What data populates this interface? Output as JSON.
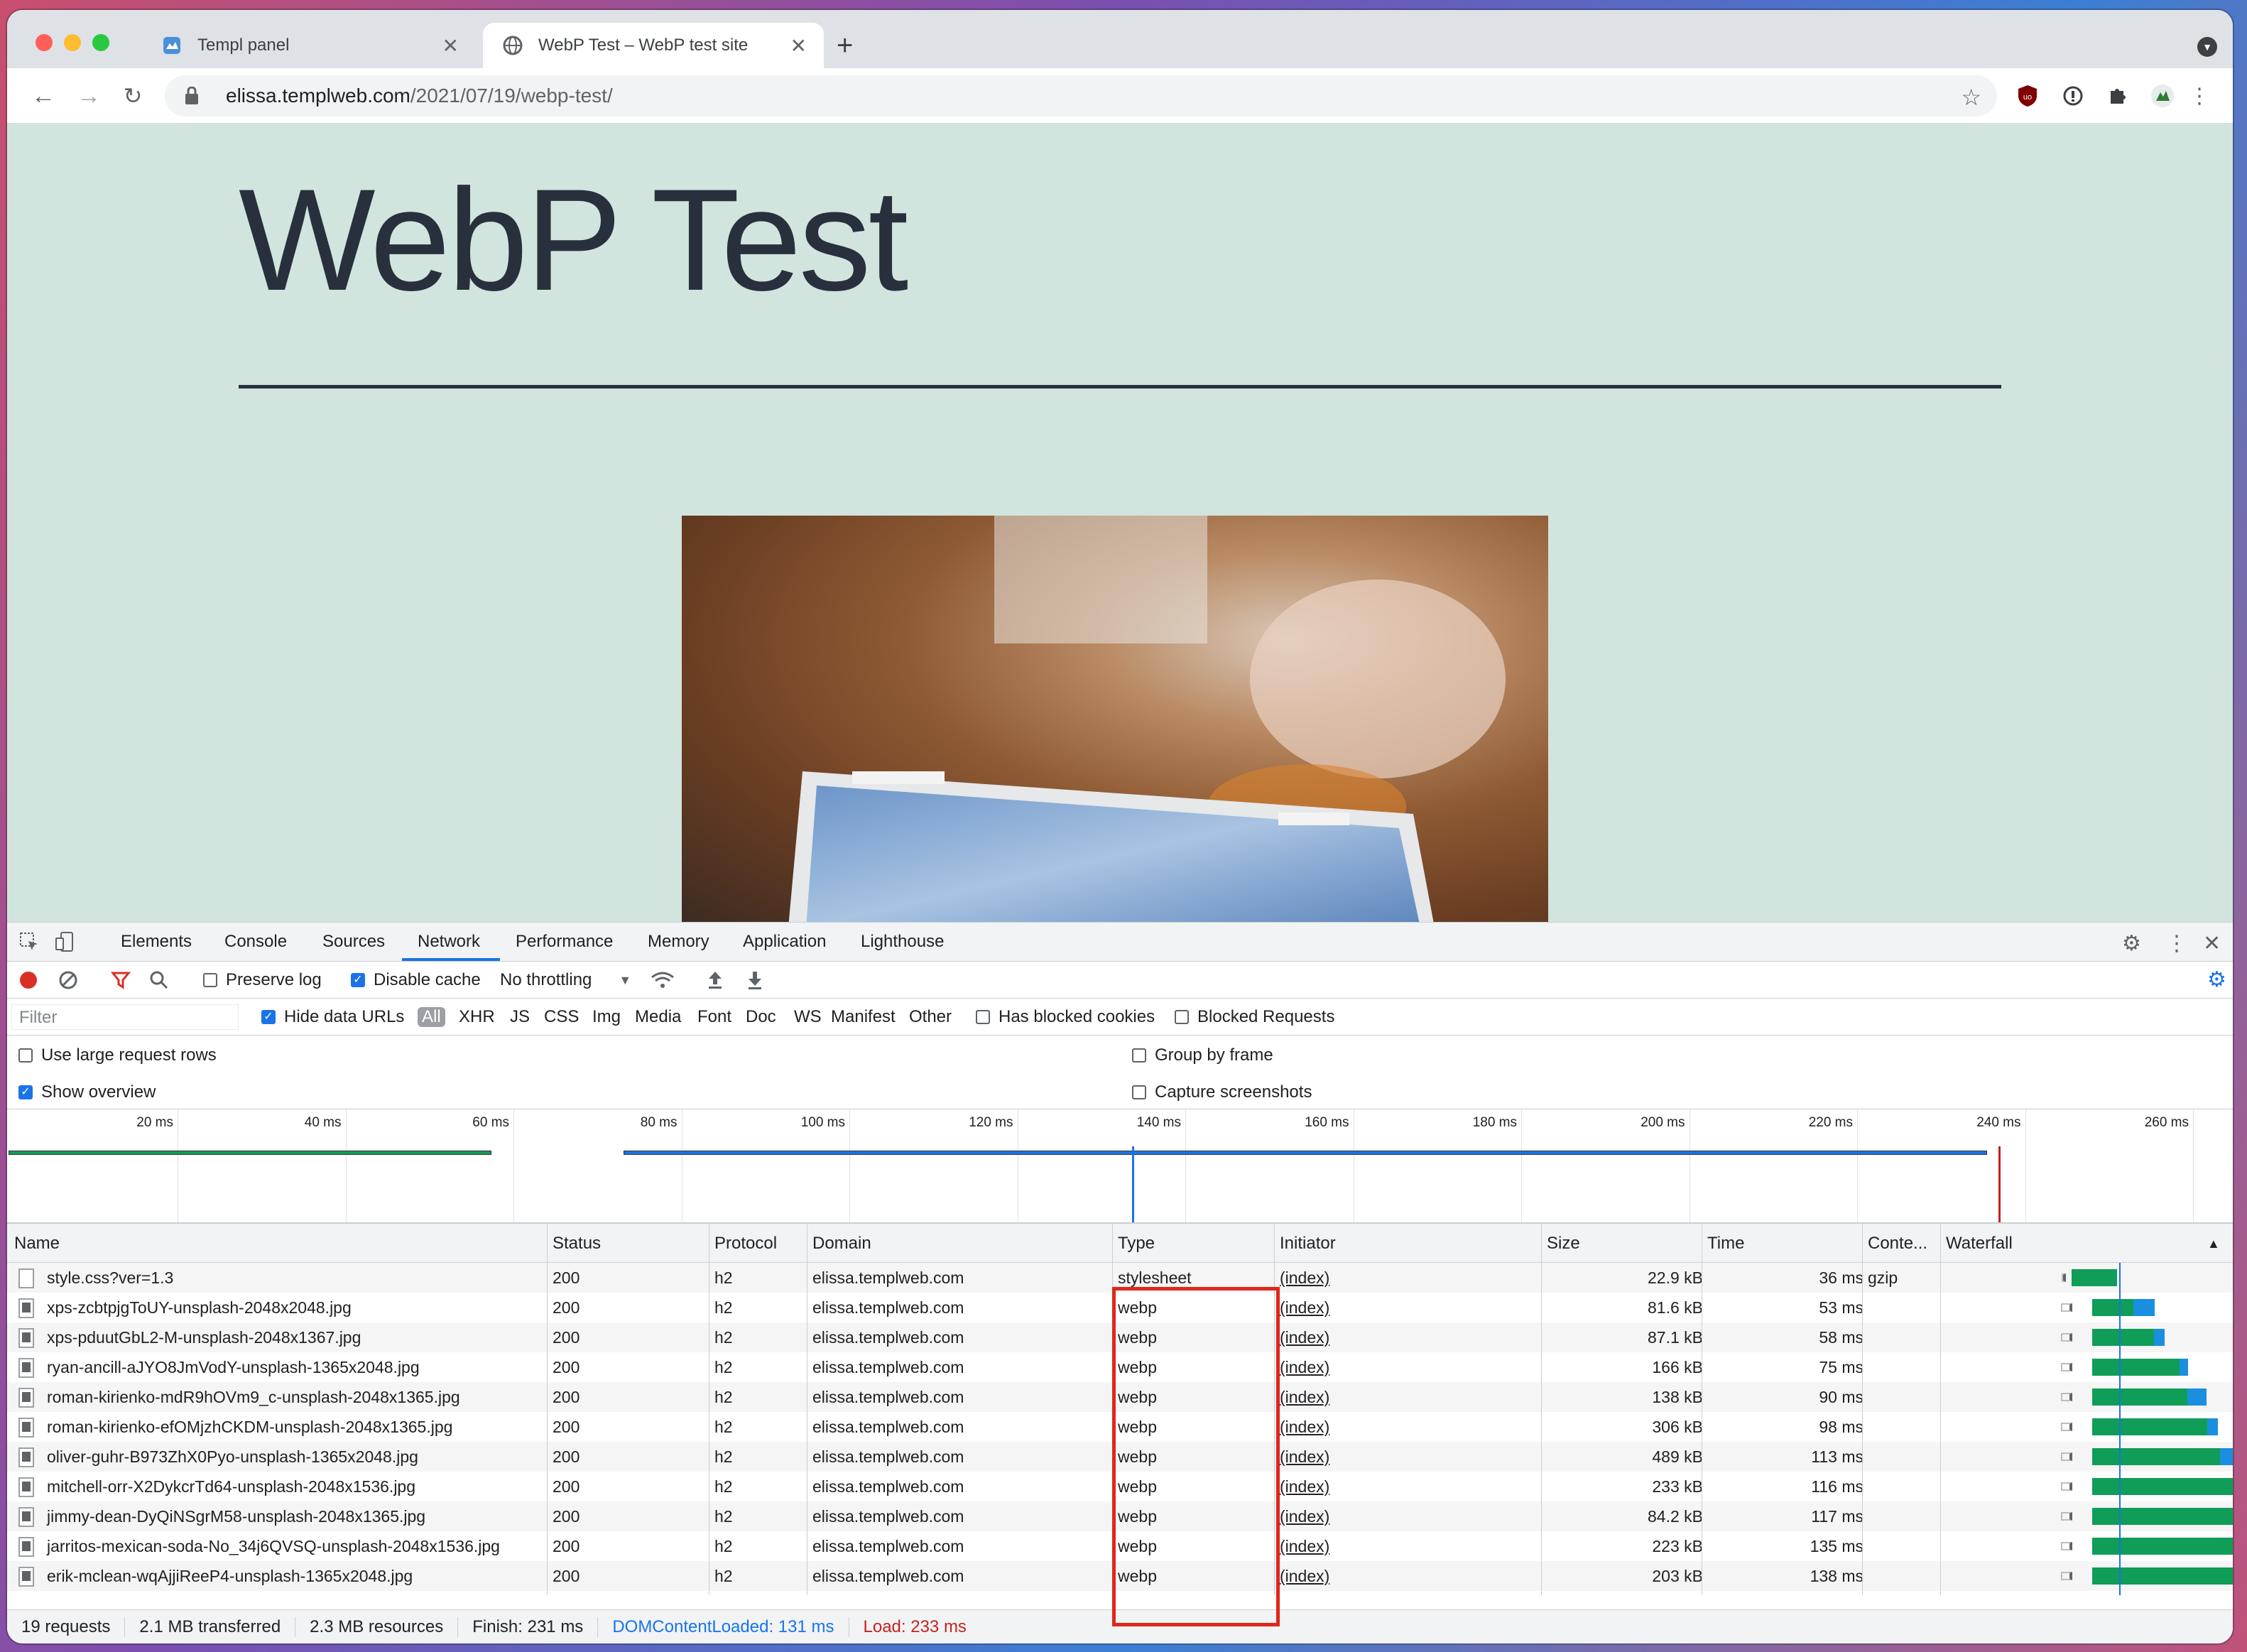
{
  "browser": {
    "tabs": [
      {
        "label": "Templ panel",
        "icon": "templ-logo-icon"
      },
      {
        "label": "WebP Test – WebP test site",
        "icon": "globe-icon",
        "active": true
      }
    ],
    "url_host": "elissa.templweb.com",
    "url_path": "/2021/07/19/webp-test/"
  },
  "page": {
    "title": "WebP Test"
  },
  "devtools": {
    "tabs": [
      "Elements",
      "Console",
      "Sources",
      "Network",
      "Performance",
      "Memory",
      "Application",
      "Lighthouse"
    ],
    "active_tab": "Network",
    "toolbar": {
      "preserve_log": "Preserve log",
      "disable_cache": "Disable cache",
      "throttling": "No throttling"
    },
    "filter": {
      "placeholder": "Filter",
      "hide_data_urls": "Hide data URLs",
      "types": [
        "All",
        "XHR",
        "JS",
        "CSS",
        "Img",
        "Media",
        "Font",
        "Doc",
        "WS",
        "Manifest",
        "Other"
      ],
      "has_blocked_cookies": "Has blocked cookies",
      "blocked_requests": "Blocked Requests"
    },
    "options": {
      "large_rows": "Use large request rows",
      "group_by_frame": "Group by frame",
      "show_overview": "Show overview",
      "capture_screenshots": "Capture screenshots"
    },
    "overview_ticks": [
      "20 ms",
      "40 ms",
      "60 ms",
      "80 ms",
      "100 ms",
      "120 ms",
      "140 ms",
      "160 ms",
      "180 ms",
      "200 ms",
      "220 ms",
      "240 ms",
      "260 ms"
    ],
    "columns": [
      "Name",
      "Status",
      "Protocol",
      "Domain",
      "Type",
      "Initiator",
      "Size",
      "Time",
      "Conte...",
      "Waterfall"
    ],
    "rows": [
      {
        "name": "style.css?ver=1.3",
        "status": "200",
        "protocol": "h2",
        "domain": "elissa.templweb.com",
        "type": "stylesheet",
        "initiator": "(index)",
        "size": "22.9 kB",
        "time": "36 ms",
        "content": "gzip",
        "wf_start": 0.455,
        "wf_wait": 0.02,
        "wf_green": 0.18,
        "wf_blue": 0.0
      },
      {
        "name": "xps-zcbtpjgToUY-unsplash-2048x2048.jpg",
        "status": "200",
        "protocol": "h2",
        "domain": "elissa.templweb.com",
        "type": "webp",
        "initiator": "(index)",
        "size": "81.6 kB",
        "time": "53 ms",
        "content": "",
        "wf_start": 0.45,
        "wf_wait": 0.13,
        "wf_green": 0.16,
        "wf_blue": 0.1
      },
      {
        "name": "xps-pduutGbL2-M-unsplash-2048x1367.jpg",
        "status": "200",
        "protocol": "h2",
        "domain": "elissa.templweb.com",
        "type": "webp",
        "initiator": "(index)",
        "size": "87.1 kB",
        "time": "58 ms",
        "content": "",
        "wf_start": 0.45,
        "wf_wait": 0.13,
        "wf_green": 0.24,
        "wf_blue": 0.05
      },
      {
        "name": "ryan-ancill-aJYO8JmVodY-unsplash-1365x2048.jpg",
        "status": "200",
        "protocol": "h2",
        "domain": "elissa.templweb.com",
        "type": "webp",
        "initiator": "(index)",
        "size": "166 kB",
        "time": "75 ms",
        "content": "",
        "wf_start": 0.45,
        "wf_wait": 0.13,
        "wf_green": 0.34,
        "wf_blue": 0.04
      },
      {
        "name": "roman-kirienko-mdR9hOVm9_c-unsplash-2048x1365.jpg",
        "status": "200",
        "protocol": "h2",
        "domain": "elissa.templweb.com",
        "type": "webp",
        "initiator": "(index)",
        "size": "138 kB",
        "time": "90 ms",
        "content": "",
        "wf_start": 0.45,
        "wf_wait": 0.13,
        "wf_green": 0.37,
        "wf_blue": 0.09
      },
      {
        "name": "roman-kirienko-efOMjzhCKDM-unsplash-2048x1365.jpg",
        "status": "200",
        "protocol": "h2",
        "domain": "elissa.templweb.com",
        "type": "webp",
        "initiator": "(index)",
        "size": "306 kB",
        "time": "98 ms",
        "content": "",
        "wf_start": 0.45,
        "wf_wait": 0.13,
        "wf_green": 0.45,
        "wf_blue": 0.05
      },
      {
        "name": "oliver-guhr-B973ZhX0Pyo-unsplash-1365x2048.jpg",
        "status": "200",
        "protocol": "h2",
        "domain": "elissa.templweb.com",
        "type": "webp",
        "initiator": "(index)",
        "size": "489 kB",
        "time": "113 ms",
        "content": "",
        "wf_start": 0.45,
        "wf_wait": 0.13,
        "wf_green": 0.5,
        "wf_blue": 0.1
      },
      {
        "name": "mitchell-orr-X2DykcrTd64-unsplash-2048x1536.jpg",
        "status": "200",
        "protocol": "h2",
        "domain": "elissa.templweb.com",
        "type": "webp",
        "initiator": "(index)",
        "size": "233 kB",
        "time": "116 ms",
        "content": "",
        "wf_start": 0.45,
        "wf_wait": 0.13,
        "wf_green": 0.56,
        "wf_blue": 0.04
      },
      {
        "name": "jimmy-dean-DyQiNSgrM58-unsplash-2048x1365.jpg",
        "status": "200",
        "protocol": "h2",
        "domain": "elissa.templweb.com",
        "type": "webp",
        "initiator": "(index)",
        "size": "84.2 kB",
        "time": "117 ms",
        "content": "",
        "wf_start": 0.45,
        "wf_wait": 0.13,
        "wf_green": 0.59,
        "wf_blue": 0.02
      },
      {
        "name": "jarritos-mexican-soda-No_34j6QVSQ-unsplash-2048x1536.jpg",
        "status": "200",
        "protocol": "h2",
        "domain": "elissa.templweb.com",
        "type": "webp",
        "initiator": "(index)",
        "size": "223 kB",
        "time": "135 ms",
        "content": "",
        "wf_start": 0.45,
        "wf_wait": 0.13,
        "wf_green": 0.59,
        "wf_blue": 0.1
      },
      {
        "name": "erik-mclean-wqAjjiReeP4-unsplash-1365x2048.jpg",
        "status": "200",
        "protocol": "h2",
        "domain": "elissa.templweb.com",
        "type": "webp",
        "initiator": "(index)",
        "size": "203 kB",
        "time": "138 ms",
        "content": "",
        "wf_start": 0.45,
        "wf_wait": 0.13,
        "wf_green": 0.72,
        "wf_blue": 0.0
      }
    ],
    "status": {
      "requests": "19 requests",
      "transferred": "2.1 MB transferred",
      "resources": "2.3 MB resources",
      "finish": "Finish: 231 ms",
      "dcl": "DOMContentLoaded: 131 ms",
      "load": "Load: 233 ms"
    },
    "colors": {
      "dcl": "#1a73e8",
      "load": "#c5221f",
      "green": "#0f9d58",
      "blue": "#1a8fe0"
    }
  }
}
